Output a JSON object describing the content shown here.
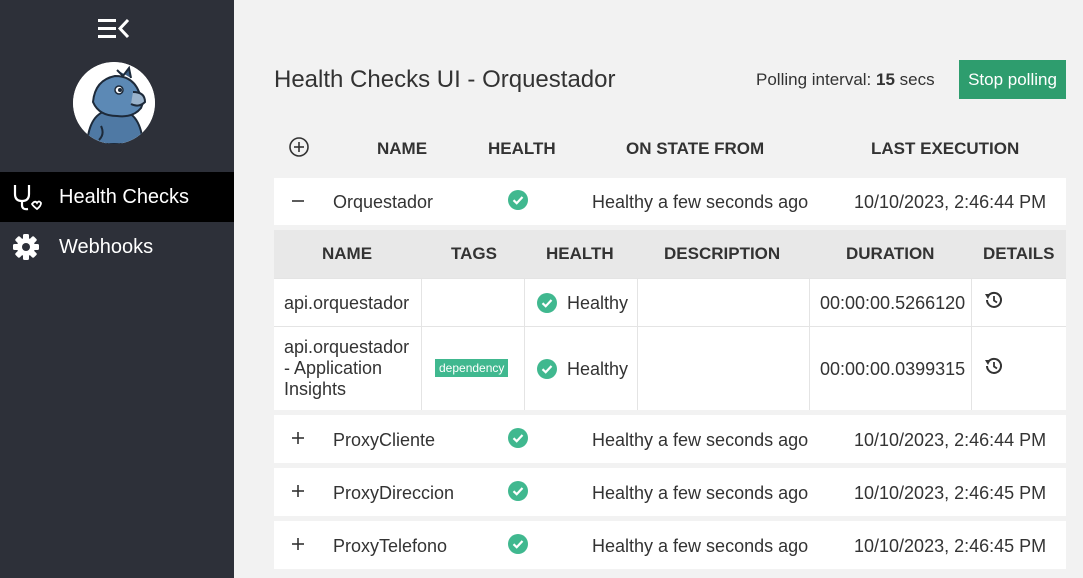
{
  "sidebar": {
    "items": [
      {
        "label": "Health Checks",
        "icon": "stethoscope-icon",
        "active": true
      },
      {
        "label": "Webhooks",
        "icon": "gear-icon",
        "active": false
      }
    ]
  },
  "header": {
    "title": "Health Checks UI - Orquestador",
    "polling_prefix": "Polling interval:",
    "polling_value": "15",
    "polling_suffix": "secs",
    "stop_label": "Stop polling"
  },
  "columns": {
    "name": "NAME",
    "health": "HEALTH",
    "on_state_from": "ON STATE FROM",
    "last_execution": "LAST EXECUTION"
  },
  "services": [
    {
      "name": "Orquestador",
      "expanded": true,
      "state": "Healthy a few seconds ago",
      "last": "10/10/2023, 2:46:44 PM"
    },
    {
      "name": "ProxyCliente",
      "expanded": false,
      "state": "Healthy a few seconds ago",
      "last": "10/10/2023, 2:46:44 PM"
    },
    {
      "name": "ProxyDireccion",
      "expanded": false,
      "state": "Healthy a few seconds ago",
      "last": "10/10/2023, 2:46:45 PM"
    },
    {
      "name": "ProxyTelefono",
      "expanded": false,
      "state": "Healthy a few seconds ago",
      "last": "10/10/2023, 2:46:45 PM"
    }
  ],
  "detail": {
    "columns": {
      "name": "NAME",
      "tags": "TAGS",
      "health": "HEALTH",
      "description": "DESCRIPTION",
      "duration": "DURATION",
      "details": "DETAILS"
    },
    "entries": [
      {
        "name_lines": [
          "api.orquestador"
        ],
        "tag": "",
        "health": "Healthy",
        "description": "",
        "duration": "00:00:00.5266120"
      },
      {
        "name_lines": [
          "api.orquestador",
          "- Application",
          "Insights"
        ],
        "tag": "dependency",
        "health": "Healthy",
        "description": "",
        "duration": "00:00:00.0399315"
      }
    ]
  },
  "colors": {
    "sidebar_bg": "#2d3039",
    "active_bg": "#000000",
    "accent": "#2e9d6e",
    "healthy": "#40b88f",
    "page_bg": "#f2f2f2"
  }
}
